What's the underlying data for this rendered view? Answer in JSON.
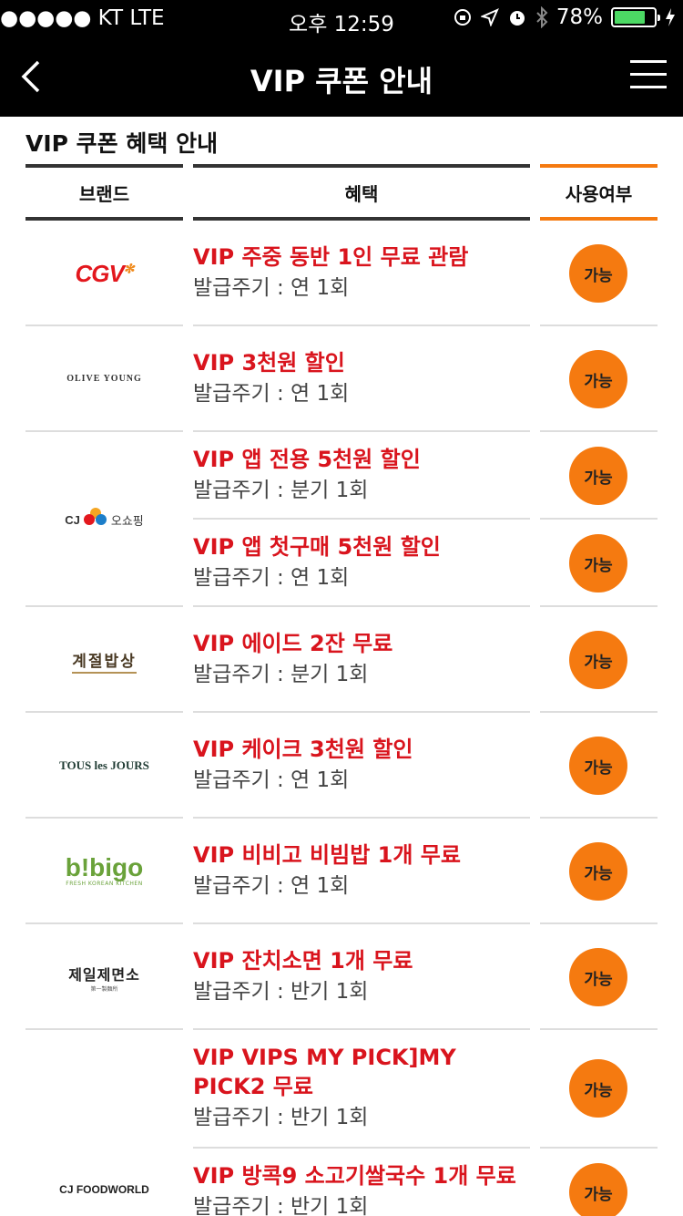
{
  "status_bar": {
    "carrier": "●●●●● KT   LTE",
    "time": "오후 12:59",
    "battery_percent": "78%",
    "battery_level": 0.78,
    "icons": [
      "lock-rotation-icon",
      "location-icon",
      "alarm-icon",
      "bluetooth-icon",
      "charging-icon"
    ]
  },
  "nav": {
    "title": "VIP 쿠폰 안내",
    "back_icon": "chevron-left-icon",
    "menu_icon": "hamburger-menu-icon"
  },
  "section": {
    "title": "VIP 쿠폰 혜택 안내",
    "headers": {
      "brand": "브랜드",
      "benefit": "혜택",
      "usage": "사용여부"
    }
  },
  "brands": [
    {
      "name": "CGV",
      "logo_text": "CGV"
    },
    {
      "name": "OLIVE YOUNG",
      "logo_text": "OLIVE YOUNG"
    },
    {
      "name": "CJ 오쇼핑",
      "logo_text": "CJ",
      "logo_sub": "오쇼핑"
    },
    {
      "name": "계절밥상",
      "logo_text": "계절밥상"
    },
    {
      "name": "TOUS les JOURS",
      "logo_text": "TOUS les JOURS"
    },
    {
      "name": "bibigo",
      "logo_text": "b!bigo",
      "logo_sub": "FRESH KOREAN KITCHEN"
    },
    {
      "name": "제일제면소",
      "logo_text": "제일제면소",
      "logo_sub": "第一製麵所"
    },
    {
      "name": "CJ FOODWORLD",
      "logo_text": "CJ FOODWORLD"
    }
  ],
  "coupons": [
    {
      "title": "VIP 주중 동반 1인 무료 관람",
      "cycle": "발급주기 : 연 1회",
      "status": "가능"
    },
    {
      "title": "VIP 3천원 할인",
      "cycle": "발급주기 : 연 1회",
      "status": "가능"
    },
    {
      "title": "VIP 앱 전용 5천원 할인",
      "cycle": "발급주기 : 분기 1회",
      "status": "가능"
    },
    {
      "title": "VIP 앱 첫구매 5천원 할인",
      "cycle": "발급주기 : 연 1회",
      "status": "가능"
    },
    {
      "title": "VIP 에이드 2잔 무료",
      "cycle": "발급주기 : 분기 1회",
      "status": "가능"
    },
    {
      "title": "VIP 케이크 3천원 할인",
      "cycle": "발급주기 : 연 1회",
      "status": "가능"
    },
    {
      "title": "VIP 비비고 비빔밥 1개 무료",
      "cycle": "발급주기 : 연 1회",
      "status": "가능"
    },
    {
      "title": "VIP 잔치소면 1개 무료",
      "cycle": "발급주기 : 반기 1회",
      "status": "가능"
    },
    {
      "title": "VIP VIPS MY PICK]MY PICK2 무료",
      "cycle": "발급주기 : 반기 1회",
      "status": "가능"
    },
    {
      "title": "VIP 방콕9 소고기쌀국수 1개 무료",
      "cycle": "발급주기 : 반기 1회",
      "status": "가능"
    }
  ],
  "colors": {
    "accent_orange": "#f57a10",
    "benefit_red": "#d9141d",
    "header_black": "#000000"
  }
}
